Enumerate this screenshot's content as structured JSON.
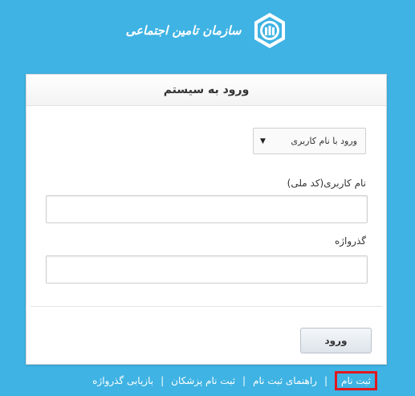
{
  "brand": {
    "name": "سازمان تامین اجتماعی",
    "logo_icon": "social-security-emblem-icon"
  },
  "login": {
    "title": "ورود به سیستم",
    "method_select": {
      "value": "ورود با نام کاربری",
      "arrow": "▼"
    },
    "username": {
      "label": "نام کاربری(کد ملی)",
      "value": ""
    },
    "password": {
      "label": "گذرواژه",
      "value": ""
    },
    "submit_label": "ورود"
  },
  "footer": {
    "links": [
      "ثبت نام",
      "راهنمای ثبت نام",
      "ثبت نام پزشکان",
      "بازیابی گذرواژه"
    ],
    "separator": "|",
    "highlight_color": "#e0191f"
  },
  "colors": {
    "background": "#3fb3e3",
    "panel": "#ffffff"
  }
}
